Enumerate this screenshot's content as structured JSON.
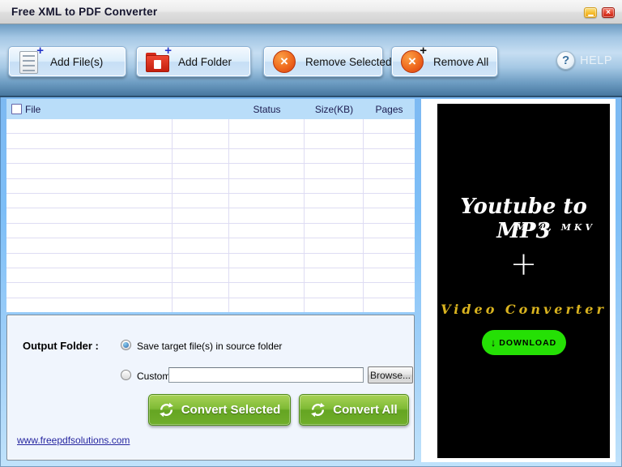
{
  "window": {
    "title": "Free XML to PDF Converter"
  },
  "icons": {
    "close": "×",
    "remove_x": "×",
    "plus": "+",
    "help_qmark": "?",
    "download_arrow": "↓"
  },
  "toolbar": {
    "buttons": [
      {
        "label": "Add File(s)"
      },
      {
        "label": "Add Folder"
      },
      {
        "label": "Remove Selected"
      },
      {
        "label": "Remove All"
      }
    ],
    "help_label": "HELP"
  },
  "file_table": {
    "headers": {
      "file": "File",
      "status": "Status",
      "size": "Size(KB)",
      "pages": "Pages"
    },
    "empty_row_count": 13,
    "rows": []
  },
  "output_panel": {
    "label": "Output Folder :",
    "radio_save": {
      "label": "Save target file(s) in source folder",
      "selected": true
    },
    "radio_customize": {
      "label": "Customize :",
      "selected": false
    },
    "path_value": "",
    "browse_label": "Browse...",
    "convert_selected_label": "Convert Selected",
    "convert_all_label": "Convert All",
    "website_link": "www.freepdfsolutions.com"
  },
  "ad": {
    "title": "Youtube to MP3",
    "subtitle": "MP4, MKV",
    "plus_sign": "+",
    "secondary_title": "Video Converter",
    "download_label": "DOWNLOAD",
    "colors": {
      "accent_yellow": "#d9b31f",
      "download_green": "#25e005",
      "background": "#000000"
    }
  }
}
